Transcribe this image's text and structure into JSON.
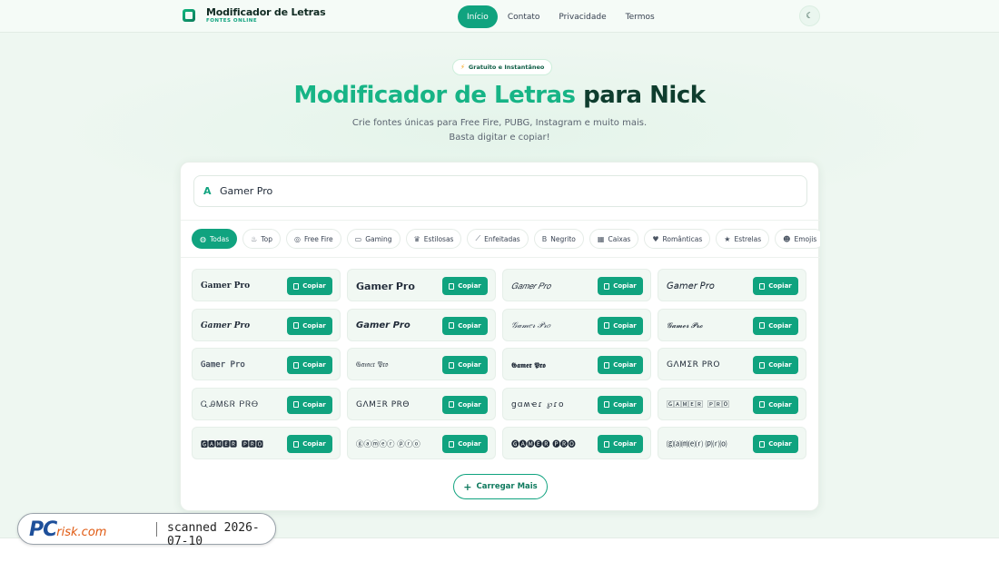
{
  "brand": {
    "title": "Modificador de Letras",
    "subtitle": "FONTES ONLINE"
  },
  "nav": {
    "links": [
      {
        "label": "Início",
        "active": true
      },
      {
        "label": "Contato",
        "active": false
      },
      {
        "label": "Privacidade",
        "active": false
      },
      {
        "label": "Termos",
        "active": false
      }
    ],
    "theme_toggle_icon": "moon-icon"
  },
  "hero": {
    "badge": "Gratuito e Instantâneo",
    "badge_icon": "lightning-icon",
    "title_accent": "Modificador de Letras",
    "title_rest": "para Nick",
    "subtitle_line1": "Crie fontes únicas para Free Fire, PUBG, Instagram e muito mais.",
    "subtitle_line2": "Basta digitar e copiar!"
  },
  "input": {
    "value": "Gamer Pro",
    "icon": "letter-a-icon"
  },
  "categories": [
    {
      "label": "Todas",
      "icon": "globe-icon",
      "active": true
    },
    {
      "label": "Top",
      "icon": "fire-icon",
      "active": false
    },
    {
      "label": "Free Fire",
      "icon": "target-icon",
      "active": false
    },
    {
      "label": "Gaming",
      "icon": "gamepad-icon",
      "active": false
    },
    {
      "label": "Estilosas",
      "icon": "crown-icon",
      "active": false
    },
    {
      "label": "Enfeitadas",
      "icon": "wand-icon",
      "active": false
    },
    {
      "label": "Negrito",
      "icon": "bold-icon",
      "active": false
    },
    {
      "label": "Caixas",
      "icon": "grid-icon",
      "active": false
    },
    {
      "label": "Românticas",
      "icon": "heart-icon",
      "active": false
    },
    {
      "label": "Estrelas",
      "icon": "star-icon",
      "active": false
    },
    {
      "label": "Emojis",
      "icon": "smile-icon",
      "active": false
    }
  ],
  "copy_label": "Copiar",
  "fonts": [
    {
      "text": "𝐆𝐚𝐦𝐞𝐫 𝐏𝐫𝐨",
      "style": "f-serif"
    },
    {
      "text": "𝗚𝗮𝗺𝗲𝗿 𝗣𝗿𝗼",
      "style": "f-bold"
    },
    {
      "text": "𝐺𝑎𝑚𝑒𝑟 𝑃𝑟𝑜",
      "style": "f-italic-serif"
    },
    {
      "text": "𝘎𝘢𝘮𝘦𝘳 𝘗𝘳𝘰",
      "style": "f-italic"
    },
    {
      "text": "𝑮𝒂𝒎𝒆𝒓 𝑷𝒓𝒐",
      "style": "f-bold-italic-serif"
    },
    {
      "text": "𝙂𝙖𝙢𝙚𝙧 𝙋𝙧𝙤",
      "style": "f-bold-italic"
    },
    {
      "text": "𝒢𝒶𝓂𝑒𝓇 𝒫𝓇𝑜",
      "style": "f-outline-italic"
    },
    {
      "text": "𝓖𝓪𝓶𝓮𝓻 𝓟𝓻𝓸",
      "style": "f-script"
    },
    {
      "text": "𝙶𝚊𝚖𝚎𝚛 𝙿𝚛𝚘",
      "style": "f-mono-bold"
    },
    {
      "text": "𝔊𝔞𝔪𝔢𝔯 𝔓𝔯𝔬",
      "style": "f-gothic"
    },
    {
      "text": "𝕲𝖆𝖒𝖊𝖗 𝕻𝖗𝖔",
      "style": "f-gothic-bold"
    },
    {
      "text": "GΛMΣR PRO",
      "style": "f-caps"
    },
    {
      "text": "ᏩᎯᎷᏋᏒ ᏢᏒᎾ",
      "style": "f-sym"
    },
    {
      "text": "GΛMΞR PRΘ",
      "style": "f-caps"
    },
    {
      "text": "ցɑʍҽɾ ℘ɾօ",
      "style": "f-sym"
    },
    {
      "text": "🄶🄰🄼🄴🅁 🄿🅁🄾",
      "style": "f-box"
    },
    {
      "text": "🅶🅰🅼🅴🆁 🅿🆁🅾",
      "style": "f-box"
    },
    {
      "text": "ⓖⓐⓜⓔⓡ ⓟⓡⓞ",
      "style": "f-circle"
    },
    {
      "text": "🅖🅐🅜🅔🅡 🅟🅡🅞",
      "style": "f-circle"
    },
    {
      "text": "⒢⒜⒨⒠⒭ ⒫⒭⒪",
      "style": "f-paren"
    }
  ],
  "load_more": "Carregar Mais",
  "watermark": {
    "brand_pc": "PC",
    "brand_risk": "risk.com",
    "scanned": "scanned 2026-07-10"
  },
  "colors": {
    "accent": "#10a37f",
    "accent_light": "#17b486",
    "dark": "#0f3d2e",
    "page_bg": "#eef7f1"
  }
}
